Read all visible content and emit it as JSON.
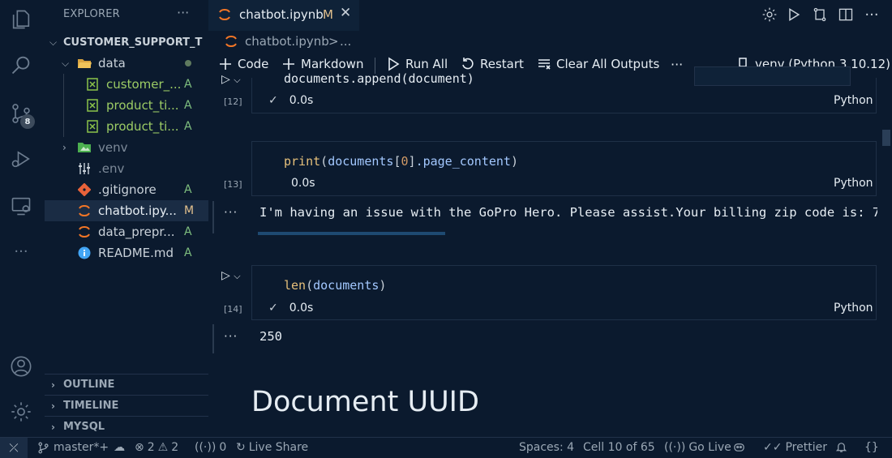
{
  "sidebar": {
    "title": "EXPLORER",
    "more": "···",
    "tree": [
      {
        "label": "CUSTOMER_SUPPORT_TI...",
        "status": ""
      },
      {
        "label": "data",
        "status": ""
      },
      {
        "label": "customer_...",
        "status": "A"
      },
      {
        "label": "product_ti...",
        "status": "A"
      },
      {
        "label": "product_ti...",
        "status": "A"
      },
      {
        "label": "venv",
        "status": ""
      },
      {
        "label": ".env",
        "status": ""
      },
      {
        "label": ".gitignore",
        "status": "A"
      },
      {
        "label": "chatbot.ipy...",
        "status": "M"
      },
      {
        "label": "data_prepr...",
        "status": "A"
      },
      {
        "label": "README.md",
        "status": "A"
      }
    ],
    "panels": [
      "OUTLINE",
      "TIMELINE",
      "MYSQL"
    ]
  },
  "activity": {
    "source_control_badge": "8"
  },
  "tab": {
    "label": "chatbot.ipynb",
    "modified": "M",
    "close": "✕"
  },
  "breadcrumb": {
    "file": "chatbot.ipynb",
    "sep": ">",
    "more": "..."
  },
  "toolbar": {
    "code": "Code",
    "markdown": "Markdown",
    "run_all": "Run All",
    "restart": "Restart",
    "clear": "Clear All Outputs",
    "more": "···",
    "kernel": "venv (Python 3.10.12)"
  },
  "cells": [
    {
      "count": "[12]",
      "code": "documents.append(document)",
      "time": "0.0s",
      "lang": "Python"
    },
    {
      "count": "[13]",
      "code_fn": "print",
      "code_arg": "documents",
      "code_idx": "0",
      "code_attr": ".page_content",
      "time": "0.0s",
      "lang": "Python",
      "output": "I'm having an issue with the GoPro Hero. Please assist.Your billing zip code is: 7"
    },
    {
      "count": "[14]",
      "code_fn": "len",
      "code_arg": "documents",
      "time": "0.0s",
      "lang": "Python",
      "output": "250"
    }
  ],
  "output_dots": "···",
  "markdown_heading": "Document UUID",
  "status": {
    "branch": "master*+",
    "errors": "2",
    "warnings": "2",
    "ports": "0",
    "live_share": "Live Share",
    "spaces": "Spaces: 4",
    "cell": "Cell 10 of 65",
    "go_live": "Go Live",
    "prettier": "Prettier"
  }
}
